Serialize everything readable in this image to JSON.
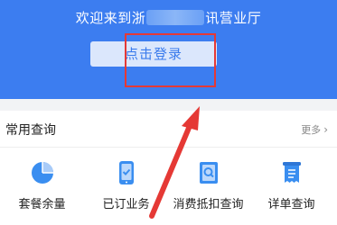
{
  "header": {
    "welcome_prefix": "欢迎来到浙",
    "welcome_suffix": "讯营业厅",
    "login_label": "点击登录"
  },
  "query": {
    "title": "常用查询",
    "more_label": "更多",
    "items": [
      {
        "label": "套餐余量",
        "icon": "pie-chart-icon"
      },
      {
        "label": "已订业务",
        "icon": "phone-check-icon"
      },
      {
        "label": "消费抵扣查询",
        "icon": "search-document-icon"
      },
      {
        "label": "详单查询",
        "icon": "receipt-icon"
      }
    ]
  },
  "colors": {
    "header_blue": "#3c7df0",
    "icon_blue": "#3a8ef0",
    "annotation_red": "#e53935"
  }
}
